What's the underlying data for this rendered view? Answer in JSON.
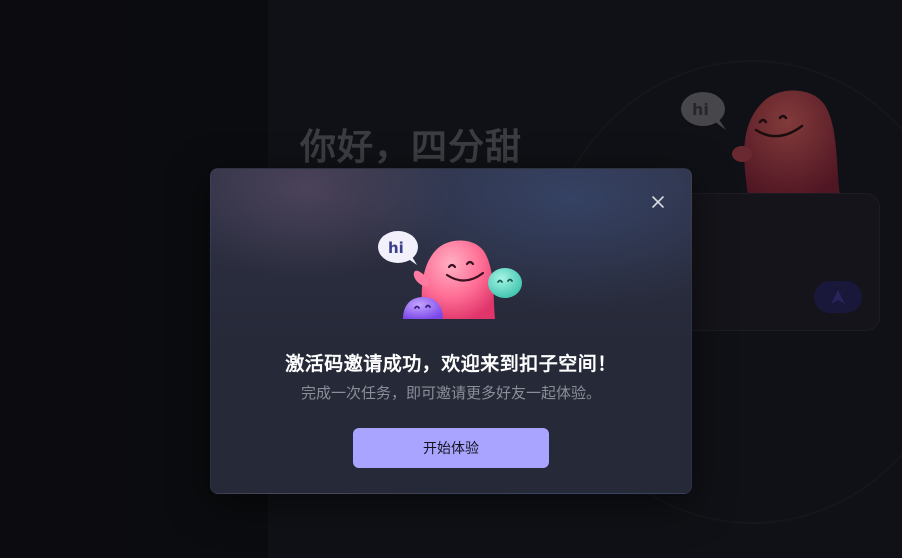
{
  "background": {
    "greeting": "你好，四分甜"
  },
  "dialog": {
    "close_icon": "close-icon",
    "illustration_bubble_text": "hi",
    "title": "激活码邀请成功，欢迎来到扣子空间！",
    "subtitle": "完成一次任务，即可邀请更多好友一起体验。",
    "start_button": "开始体验"
  },
  "colors": {
    "accent": "#a8a4ff",
    "modal_bg": "#262938",
    "mascot_pink": "#ff6f96",
    "mascot_teal": "#52d6c2",
    "mascot_purple": "#8b5cf6"
  }
}
